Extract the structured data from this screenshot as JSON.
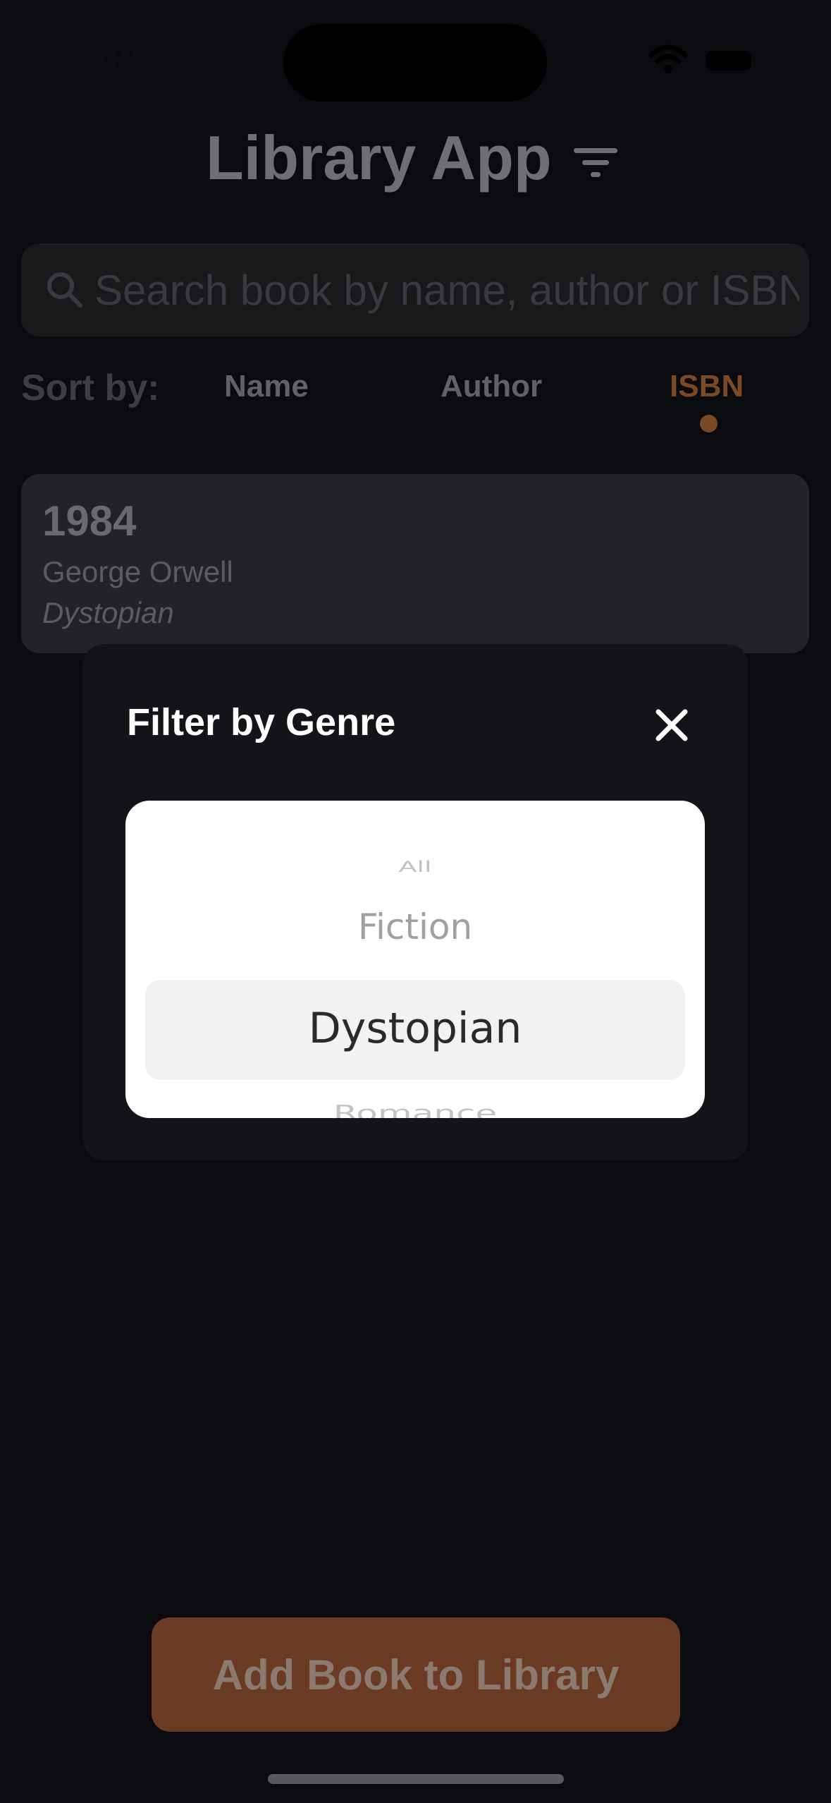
{
  "status_bar": {
    "time": "09:55"
  },
  "header": {
    "title": "Library App",
    "filter_icon": "filter-lines-icon"
  },
  "search": {
    "placeholder": "Search book by name, author or ISBN",
    "icon": "magnifier-icon"
  },
  "sort": {
    "label": "Sort by:",
    "options": [
      "Name",
      "Author",
      "ISBN"
    ],
    "active": "ISBN",
    "accent_color": "#c76f34"
  },
  "books": [
    {
      "title": "1984",
      "author": "George Orwell",
      "genre": "Dystopian"
    }
  ],
  "background_text": "",
  "add_button": {
    "label": "Add Book to Library",
    "color": "#c76f34"
  },
  "modal": {
    "title": "Filter by Genre",
    "close_icon": "close-x-icon",
    "picker": {
      "options": [
        "All",
        "Fiction",
        "Dystopian",
        "Romance"
      ],
      "selected": "Dystopian"
    }
  }
}
